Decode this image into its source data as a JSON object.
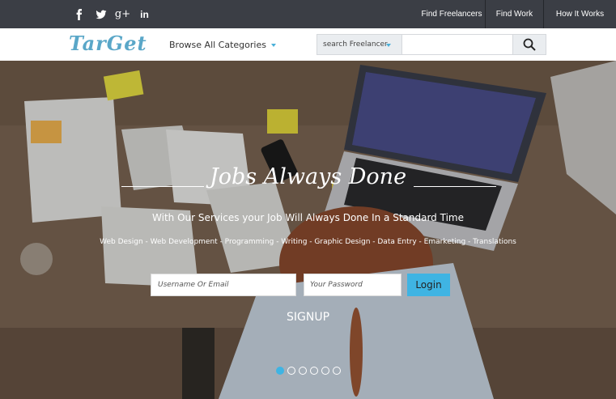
{
  "topbar": {
    "social": [
      {
        "icon": "facebook-icon",
        "glyph": "f"
      },
      {
        "icon": "twitter-icon",
        "glyph": "t"
      },
      {
        "icon": "google-plus-icon",
        "glyph": "g+"
      },
      {
        "icon": "linkedin-icon",
        "glyph": "in"
      }
    ],
    "nav": [
      "Find Freelancers",
      "Find Work",
      "How It Works"
    ]
  },
  "header": {
    "logo": "TarGet",
    "browse_label": "Browse All Categories",
    "search": {
      "select_value": "search Freelancer",
      "input_value": "",
      "button_icon": "search-icon"
    }
  },
  "hero": {
    "title": "Jobs Always Done",
    "subtitle": "With Our Services your Job Will Always Done In a Standard Time",
    "categories": "Web Design -  Web Development - Programming - Writing - Graphic Design - Data Entry  -  Emarketing - Translations",
    "login": {
      "username_placeholder": "Username Or Email",
      "password_placeholder": "Your Password",
      "button_label": "Login"
    },
    "signup_label": "SIGNUP",
    "slider": {
      "count": 6,
      "active_index": 0
    }
  },
  "colors": {
    "topbar_bg": "#3b3e45",
    "accent": "#3fb4e3",
    "logo": "#5aa7c8"
  }
}
